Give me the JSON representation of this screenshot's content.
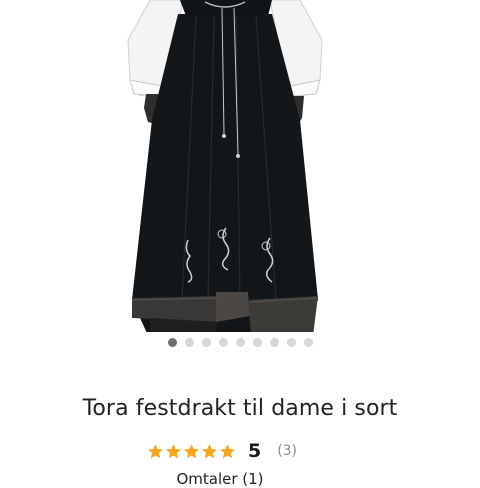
{
  "product": {
    "title": "Tora festdrakt til dame i sort",
    "image_alt": "",
    "rating": {
      "value": "5",
      "count": "(3)",
      "stars": 5,
      "star_color": "#f5a623"
    },
    "reviews_link": "Omtaler (1)"
  },
  "carousel": {
    "total": 9,
    "active_index": 0,
    "active_color": "#6f6f6f",
    "inactive_color": "#d7d7d7"
  }
}
